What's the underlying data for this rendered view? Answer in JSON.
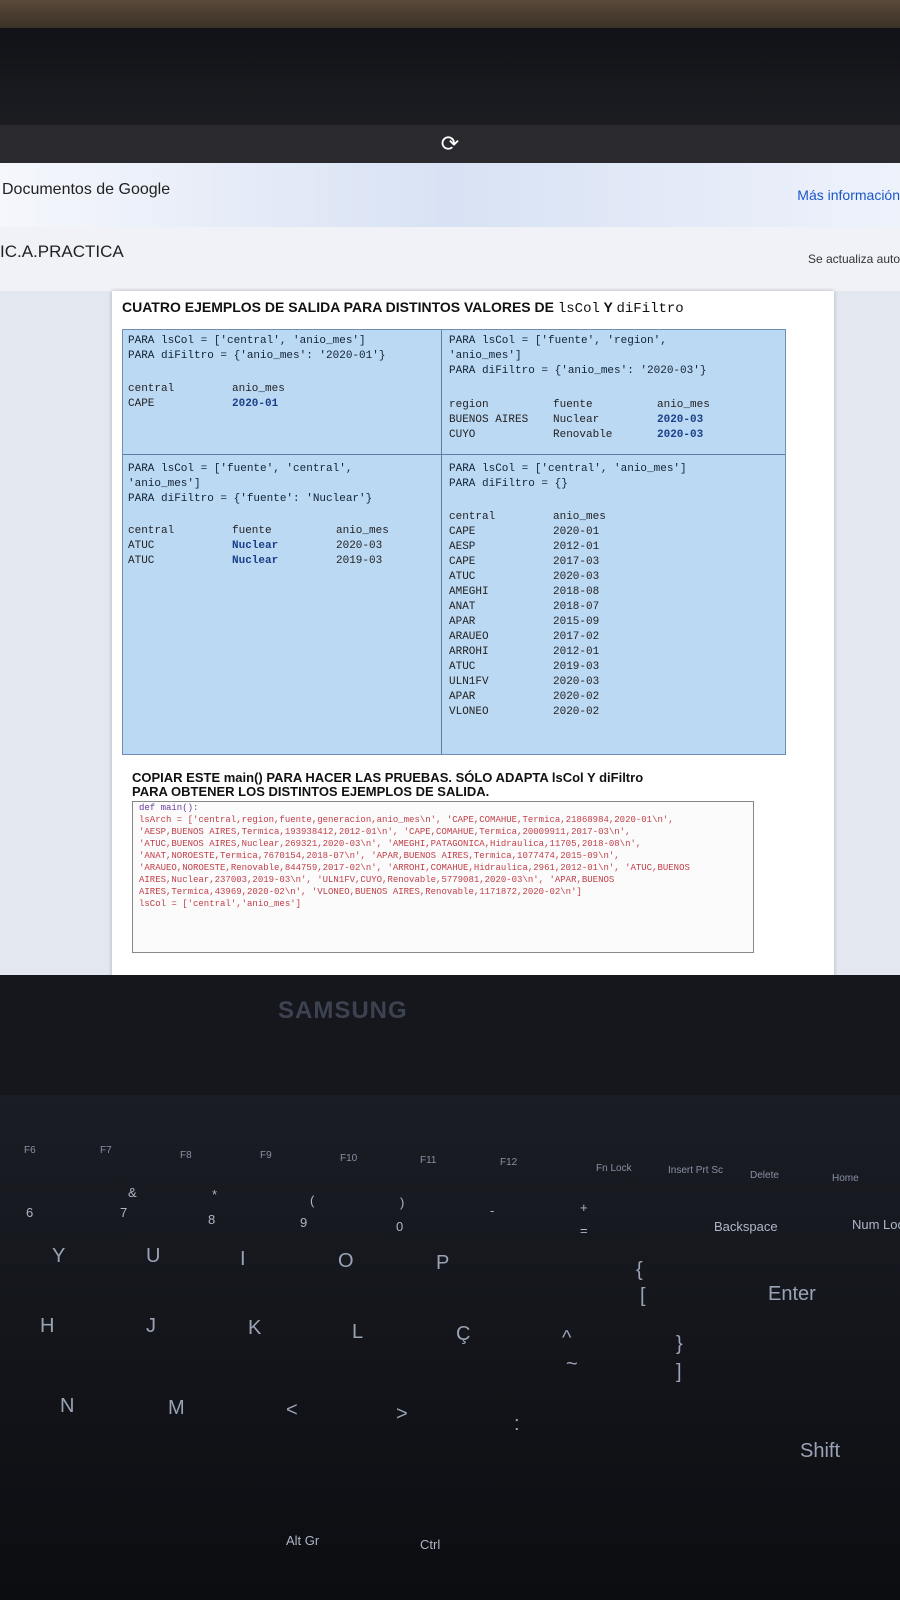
{
  "browser": {
    "gdocs_title": "Documentos de Google",
    "more_info": "Más información",
    "doc_title": "IC.A.PRACTICA",
    "autosave": "Se actualiza auto"
  },
  "page": {
    "heading_prefix": "CUATRO EJEMPLOS DE SALIDA PARA DISTINTOS VALORES DE",
    "heading_lsCol": "lsCol",
    "heading_y": "Y",
    "heading_diFiltro": "diFiltro",
    "examples": [
      {
        "lines": [
          "PARA lsCol =  ['central', 'anio_mes']",
          "PARA diFiltro =  {'anio_mes': '2020-01'}"
        ],
        "headers": [
          "central",
          "anio_mes"
        ],
        "rows": [
          [
            "CAPE",
            "2020-01"
          ]
        ]
      },
      {
        "lines": [
          "PARA lsCol =  ['fuente', 'region',",
          "'anio_mes']",
          "PARA diFiltro =  {'anio_mes': '2020-03'}"
        ],
        "headers": [
          "region",
          "fuente",
          "anio_mes"
        ],
        "rows": [
          [
            "BUENOS AIRES",
            "Nuclear",
            "2020-03"
          ],
          [
            "CUYO",
            "Renovable",
            "2020-03"
          ]
        ]
      },
      {
        "lines": [
          "PARA lsCol =  ['fuente', 'central',",
          "'anio_mes']",
          "PARA diFiltro =  {'fuente': 'Nuclear'}"
        ],
        "headers": [
          "central",
          "fuente",
          "anio_mes"
        ],
        "rows": [
          [
            "ATUC",
            "Nuclear",
            "2020-03"
          ],
          [
            "ATUC",
            "Nuclear",
            "2019-03"
          ]
        ]
      },
      {
        "lines": [
          "PARA lsCol =  ['central', 'anio_mes']",
          "PARA diFiltro =  {}"
        ],
        "headers": [
          "central",
          "anio_mes"
        ],
        "rows": [
          [
            "CAPE",
            "2020-01"
          ],
          [
            "AESP",
            "2012-01"
          ],
          [
            "CAPE",
            "2017-03"
          ],
          [
            "ATUC",
            "2020-03"
          ],
          [
            "AMEGHI",
            "2018-08"
          ],
          [
            "ANAT",
            "2018-07"
          ],
          [
            "APAR",
            "2015-09"
          ],
          [
            "ARAUEO",
            "2017-02"
          ],
          [
            "ARROHI",
            "2012-01"
          ],
          [
            "ATUC",
            "2019-03"
          ],
          [
            "ULN1FV",
            "2020-03"
          ],
          [
            "APAR",
            "2020-02"
          ],
          [
            "VLONEO",
            "2020-02"
          ]
        ]
      }
    ],
    "copy_heading_1": "COPIAR ESTE  main() PARA HACER LAS PRUEBAS. SÓLO ADAPTA lsCol  Y diFiltro",
    "copy_heading_2": "PARA OBTENER LOS DISTINTOS EJEMPLOS DE SALIDA.",
    "code_lines": [
      "def main():",
      "    lsArch = ['central,region,fuente,generacion,anio_mes\\n', 'CAPE,COMAHUE,Termica,21868984,2020-01\\n',",
      "'AESP,BUENOS AIRES,Termica,193938412,2012-01\\n', 'CAPE,COMAHUE,Termica,20009911,2017-03\\n',",
      "'ATUC,BUENOS AIRES,Nuclear,269321,2020-03\\n', 'AMEGHI,PATAGONICA,Hidraulica,11705,2018-08\\n',",
      "'ANAT,NOROESTE,Termica,7670154,2018-07\\n', 'APAR,BUENOS AIRES,Termica,1077474,2015-09\\n',",
      "'ARAUEO,NOROESTE,Renovable,844759,2017-02\\n', 'ARROHI,COMAHUE,Hidraulica,2961,2012-01\\n', 'ATUC,BUENOS",
      "AIRES,Nuclear,237003,2019-03\\n', 'ULN1FV,CUYO,Renovable,5779081,2020-03\\n', 'APAR,BUENOS",
      "AIRES,Termica,43969,2020-02\\n', 'VLONEO,BUENOS AIRES,Renovable,1171872,2020-02\\n']",
      "    lsCol  = ['central','anio_mes']"
    ]
  },
  "laptop": {
    "brand": "SAMSUNG"
  },
  "keyboard": {
    "fkeys": [
      "F6",
      "F7",
      "F8",
      "F9",
      "F10",
      "F11",
      "F12",
      "Fn Lock",
      "Insert Prt Sc",
      "Delete",
      "Home"
    ],
    "row_numbers": [
      "6",
      "&",
      "7",
      "*",
      "8",
      "(",
      "9",
      ")",
      "0",
      "-",
      "+",
      "=",
      "Backspace",
      "Num Lock"
    ],
    "row_top": [
      "Y",
      "U",
      "I",
      "O",
      "P",
      "{",
      "[",
      "Enter"
    ],
    "row_home": [
      "H",
      "J",
      "K",
      "L",
      "Ç",
      "^",
      "~",
      "}",
      "]"
    ],
    "row_bottom": [
      "N",
      "M",
      "<",
      ">",
      ":",
      "Shift"
    ],
    "row_space": [
      "Alt Gr",
      "Ctrl"
    ]
  }
}
